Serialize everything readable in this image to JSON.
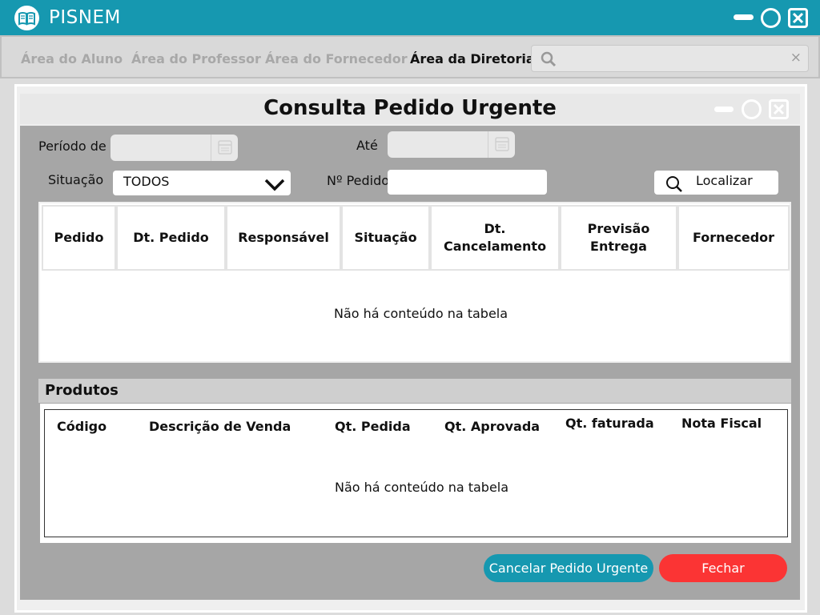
{
  "app": {
    "title": "PISNEM"
  },
  "nav": {
    "items": [
      {
        "label": "Área do Aluno",
        "active": false
      },
      {
        "label": "Área do Professor",
        "active": false
      },
      {
        "label": "Área do Fornecedor",
        "active": false
      },
      {
        "label": "Área da Diretoria",
        "active": true
      }
    ],
    "search": {
      "placeholder": "",
      "value": "",
      "clear_icon": "×"
    }
  },
  "dialog": {
    "title": "Consulta Pedido Urgente",
    "filters": {
      "periodo_label": "Período de",
      "ate_label": "Até",
      "situacao_label": "Situação",
      "situacao_value": "TODOS",
      "pedido_label": "Nº Pedido",
      "pedido_value": "",
      "localizar_label": "Localizar"
    },
    "orders_table": {
      "columns": [
        "Pedido",
        "Dt. Pedido",
        "Responsável",
        "Situação",
        "Dt. Cancelamento",
        "Previsão Entrega",
        "Fornecedor"
      ],
      "empty_message": "Não há conteúdo na tabela"
    },
    "products": {
      "title": "Produtos",
      "columns": [
        "Código",
        "Descrição de Venda",
        "Qt. Pedida",
        "Qt. Aprovada",
        "Qt. faturada",
        "Nota Fiscal"
      ],
      "empty_message": "Não há conteúdo na tabela"
    },
    "actions": {
      "cancel_label": "Cancelar Pedido Urgente",
      "close_label": "Fechar"
    }
  },
  "colors": {
    "accent": "#1698b0",
    "danger": "#fb3434",
    "panel": "#a6a6a6"
  },
  "icons": [
    "book-icon",
    "minimize-icon",
    "maximize-icon",
    "close-icon",
    "search-icon",
    "calendar-icon",
    "chevron-down-icon"
  ]
}
